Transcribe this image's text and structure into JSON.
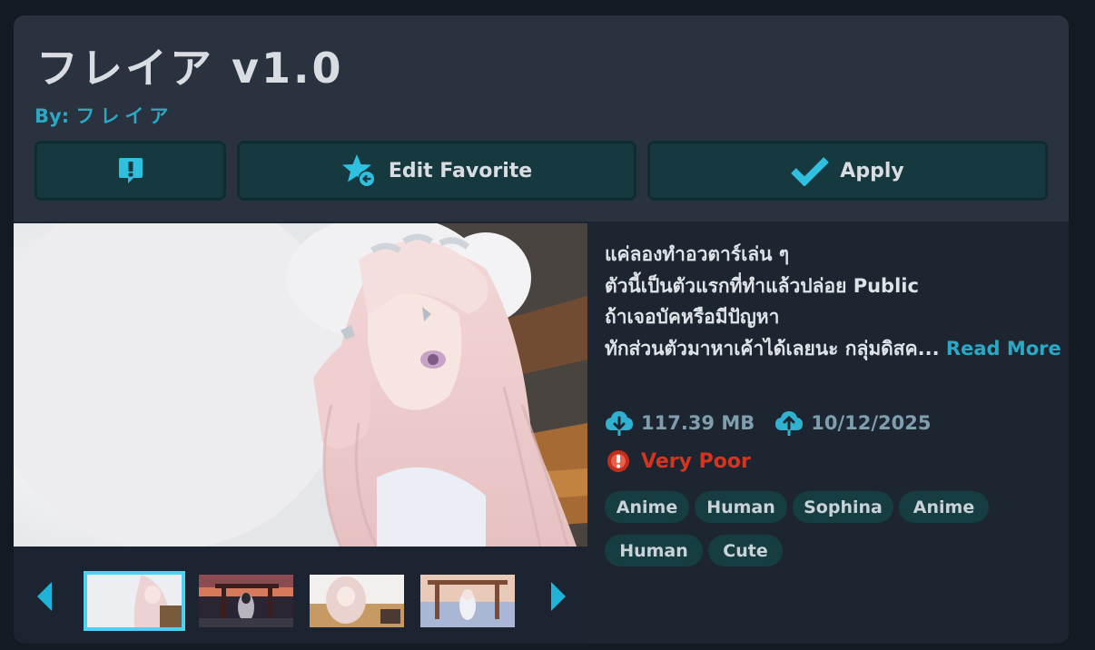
{
  "avatar": {
    "title": "フレイア v1.0",
    "author_prefix": "By:",
    "author_name": "フレイア"
  },
  "actions": {
    "report_icon": "report-exclamation-icon",
    "favorite_label": "Edit Favorite",
    "favorite_icon": "star-add-icon",
    "apply_label": "Apply",
    "apply_icon": "checkmark-icon"
  },
  "description": {
    "lines": [
      "แค่ลองทำอวตาร์เล่น ๆ",
      "ตัวนี้เป็นตัวแรกที่ทำแล้วปล่อย Public",
      "ถ้าเจอบัคหรือมีปัญหา",
      "ทักส่วนตัวมาหาเค้าได้เลยนะ กลุ่มดิสค..."
    ],
    "read_more": "Read More"
  },
  "stats": {
    "size": "117.39 MB",
    "upload_date": "10/12/2025"
  },
  "performance": {
    "rating": "Very Poor",
    "color": "#d6341f"
  },
  "tags": [
    "Anime",
    "Human",
    "Sophina",
    "Anime",
    "Human",
    "Cute"
  ],
  "gallery": {
    "thumbnails": [
      "thumbnail-1",
      "thumbnail-2",
      "thumbnail-3",
      "thumbnail-4"
    ],
    "selected": 1
  },
  "colors": {
    "accent": "#2aa9c6",
    "button_bg": "#163940",
    "panel_bg": "#1d2630",
    "header_bg": "#2a313f",
    "tag_bg": "#153d42",
    "thumb_highlight": "#4fd0ee"
  }
}
